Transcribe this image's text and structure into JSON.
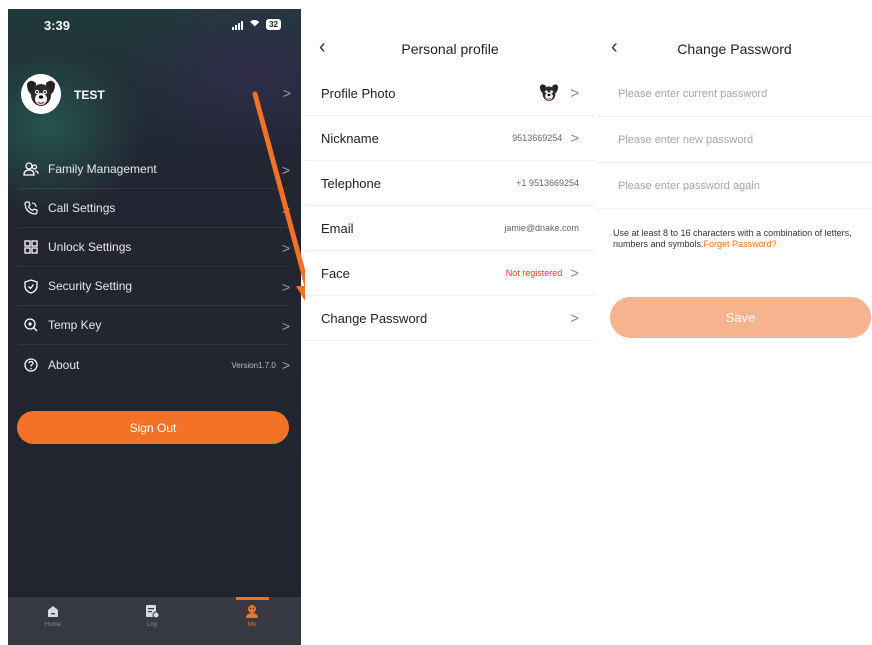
{
  "status_bar": {
    "time": "3:39",
    "battery": "32"
  },
  "profile": {
    "name": "TEST"
  },
  "menu": {
    "items": [
      {
        "label": "Family Management",
        "icon": "family-icon"
      },
      {
        "label": "Call Settings",
        "icon": "phone-icon"
      },
      {
        "label": "Unlock  Settings",
        "icon": "grid-icon"
      },
      {
        "label": "Security Setting",
        "icon": "shield-icon"
      },
      {
        "label": "Temp Key",
        "icon": "key-search-icon"
      },
      {
        "label": "About",
        "icon": "question-icon",
        "value": "Version1.7.0"
      }
    ],
    "sign_out": "Sign Out"
  },
  "tabbar": {
    "tabs": [
      {
        "label": "Home",
        "icon": "home-icon"
      },
      {
        "label": "Log",
        "icon": "log-icon"
      },
      {
        "label": "Me",
        "icon": "me-icon"
      }
    ],
    "active": "Me"
  },
  "personal_profile": {
    "title": "Personal profile",
    "rows": [
      {
        "label": "Profile Photo"
      },
      {
        "label": "Nickname",
        "value": "9513669254"
      },
      {
        "label": "Telephone",
        "value": "+1 9513669254"
      },
      {
        "label": "Email",
        "value": "jamie@dnake.com"
      },
      {
        "label": "Face",
        "value": "Not registered"
      },
      {
        "label": "Change Password"
      }
    ]
  },
  "change_password": {
    "title": "Change Password",
    "current_placeholder": "Please enter current password",
    "new_placeholder": "Please enter new password",
    "again_placeholder": "Please enter password again",
    "hint": "Use at least 8 to 16 characters with a combination of letters, numbers and symbols.",
    "forget_link": "Forget Password?",
    "save": "Save"
  },
  "colors": {
    "accent": "#f47225",
    "save_disabled": "#f8b48e",
    "error": "#e8402a",
    "dark_bg": "#22242d"
  }
}
